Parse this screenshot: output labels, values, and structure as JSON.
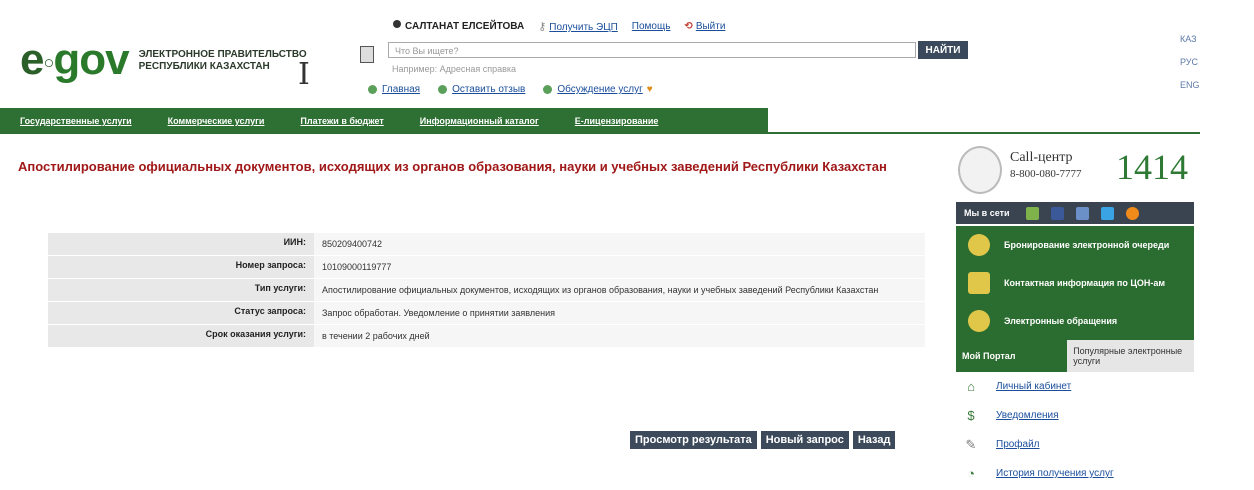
{
  "logo": {
    "wordmark_e": "e",
    "wordmark_gov": "gov",
    "line1": "ЭЛЕКТРОННОЕ ПРАВИТЕЛЬСТВО",
    "line2": "РЕСПУБЛИКИ КАЗАХСТАН"
  },
  "userbar": {
    "user_name": "САЛТАНАТ ЕЛСЕЙТОВА",
    "get_eds": "Получить ЭЦП",
    "help": "Помощь",
    "logout": "Выйти"
  },
  "search": {
    "placeholder": "Что Вы ищете?",
    "hint": "Например: Адресная справка",
    "button": "НАЙТИ"
  },
  "quicklinks": [
    {
      "label": "Главная"
    },
    {
      "label": "Оставить отзыв"
    },
    {
      "label": "Обсуждение услуг"
    }
  ],
  "languages": [
    "КАЗ",
    "РУС",
    "ENG"
  ],
  "nav": [
    "Государственные услуги",
    "Коммерческие услуги",
    "Платежи в бюджет",
    "Информационный каталог",
    "Е-лицензирование"
  ],
  "page_title": "Апостилирование официальных документов, исходящих из органов образования, науки и учебных заведений Республики Казахстан",
  "info": [
    {
      "label": "ИИН:",
      "value": "850209400742"
    },
    {
      "label": "Номер запроса:",
      "value": "10109000119777"
    },
    {
      "label": "Тип услуги:",
      "value": "Апостилирование официальных документов, исходящих из органов образования, науки и учебных заведений Республики Казахстан"
    },
    {
      "label": "Статус запроса:",
      "value": "Запрос обработан. Уведомление о принятии заявления"
    },
    {
      "label": "Срок оказания услуги:",
      "value": "в течении 2 рабочих дней"
    }
  ],
  "actions": {
    "view_result": "Просмотр результата",
    "new_request": "Новый запрос",
    "back": "Назад"
  },
  "callcenter": {
    "label": "Call-центр",
    "phone": "8-800-080-7777",
    "short_number": "1414"
  },
  "social": {
    "label": "Мы в сети"
  },
  "side_links": [
    "Бронирование электронной очереди",
    "Контактная информация по ЦОН-ам",
    "Электронные обращения"
  ],
  "portal_tabs": {
    "active": "Мой Портал",
    "inactive": "Популярные электронные услуги"
  },
  "portal_links": [
    "Личный кабинет",
    "Уведомления",
    "Профайл",
    "История получения услуг"
  ],
  "colors": {
    "brand_green": "#2e6f33",
    "title_red": "#a01818",
    "button_dark": "#3d4a5c"
  }
}
